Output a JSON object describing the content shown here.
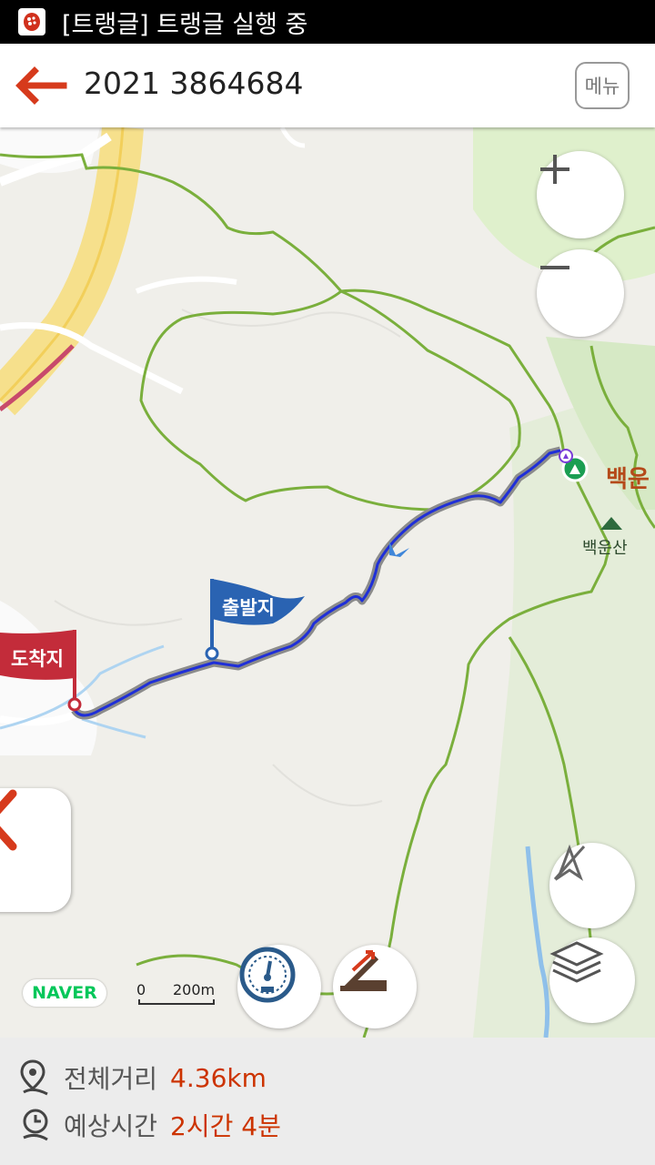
{
  "status_bar": {
    "text": "[트랭글] 트랭글 실행 중",
    "app_icon": "trangle-app-icon"
  },
  "header": {
    "title": "2021 3864684",
    "menu_label": "메뉴",
    "back_icon": "back-arrow-icon"
  },
  "map": {
    "start_flag_label": "출발지",
    "end_flag_label": "도착지",
    "peak_label": "백운산",
    "peak_label_partial": "백운",
    "zoom_in_icon": "plus-icon",
    "zoom_out_icon": "minus-icon",
    "gps_off_icon": "location-off-icon",
    "layers_icon": "layers-icon",
    "speed_icon": "speedometer-icon",
    "elevation_icon": "elevation-icon",
    "side_panel_icon": "chevron-left-icon",
    "naver_logo": "NAVER",
    "scale": {
      "zero": "0",
      "distance": "200m"
    }
  },
  "info": {
    "distance_label": "전체거리",
    "distance_value": "4.36km",
    "time_label": "예상시간",
    "time_value": "2시간 4분"
  },
  "colors": {
    "accent": "#cc3300",
    "route": "#1f2fd8",
    "trail": "#7aaf3c",
    "start_flag": "#2a63b2",
    "end_flag": "#c32c3a"
  }
}
